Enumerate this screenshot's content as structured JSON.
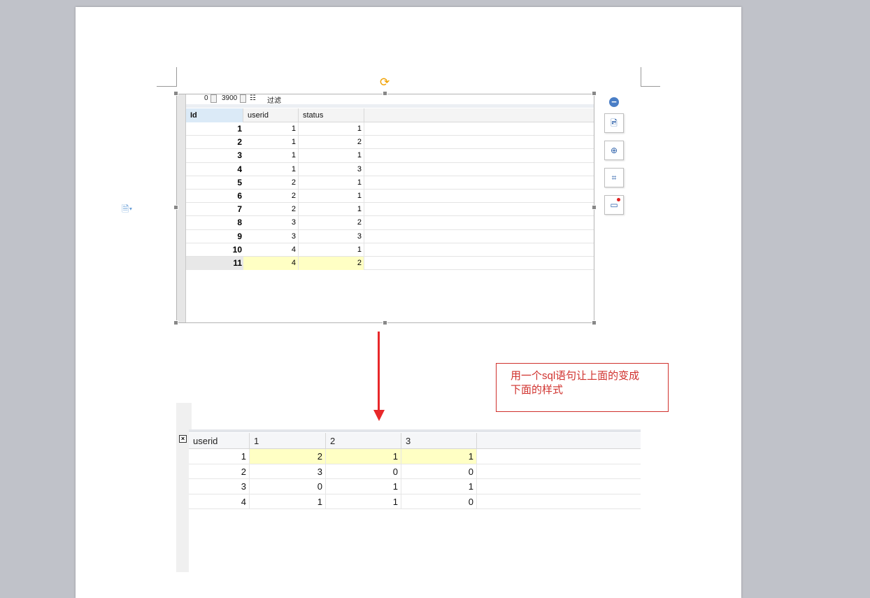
{
  "top_grid": {
    "toolbar": {
      "offset": "0",
      "limit": "3900",
      "filter_label": "过滤"
    },
    "columns": [
      "Id",
      "userid",
      "status"
    ],
    "rows": [
      [
        "1",
        "1",
        "1"
      ],
      [
        "2",
        "1",
        "2"
      ],
      [
        "3",
        "1",
        "1"
      ],
      [
        "4",
        "1",
        "3"
      ],
      [
        "5",
        "2",
        "1"
      ],
      [
        "6",
        "2",
        "1"
      ],
      [
        "7",
        "2",
        "1"
      ],
      [
        "8",
        "3",
        "2"
      ],
      [
        "9",
        "3",
        "3"
      ],
      [
        "10",
        "4",
        "1"
      ],
      [
        "11",
        "4",
        "2"
      ]
    ]
  },
  "note": {
    "line1": "用一个sql语句让上面的变成",
    "line2": "下面的样式"
  },
  "bottom_grid": {
    "columns": [
      "userid",
      "1",
      "2",
      "3"
    ],
    "rows": [
      [
        "1",
        "2",
        "1",
        "1"
      ],
      [
        "2",
        "3",
        "0",
        "0"
      ],
      [
        "3",
        "0",
        "1",
        "1"
      ],
      [
        "4",
        "1",
        "1",
        "0"
      ]
    ]
  },
  "side_tools": [
    "collapse-icon",
    "layout-options-icon",
    "zoom-in-icon",
    "crop-icon",
    "image-border-icon"
  ],
  "colors": {
    "accent_red": "#d0312d",
    "selected_row": "#ffffc4",
    "rotate_handle": "#f0a000"
  }
}
